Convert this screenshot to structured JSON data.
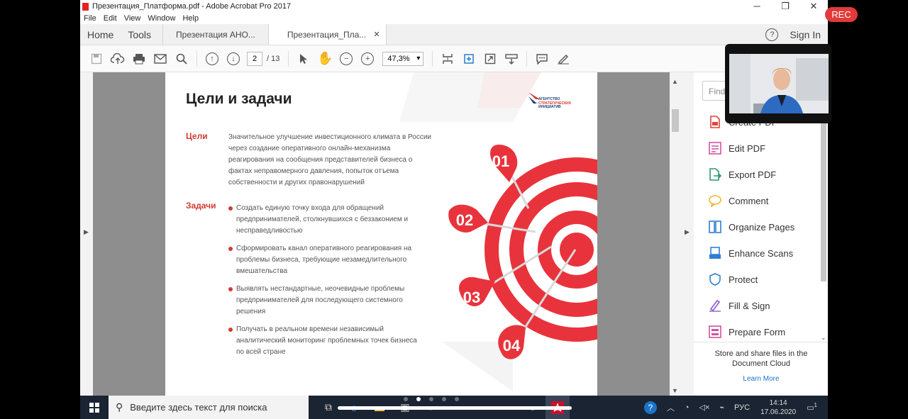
{
  "window": {
    "title": "Презентация_Платформа.pdf - Adobe Acrobat Pro 2017",
    "controls": {
      "minimize": "─",
      "maximize": "❐",
      "close": "✕"
    }
  },
  "menu": [
    "File",
    "Edit",
    "View",
    "Window",
    "Help"
  ],
  "tabs": {
    "home": "Home",
    "tools": "Tools",
    "docs": [
      {
        "label": "Презентация АНО..."
      },
      {
        "label": "Презентация_Пла...",
        "close": "✕"
      }
    ],
    "help": "?",
    "sign_in": "Sign In"
  },
  "toolbar": {
    "page_current": "2",
    "page_total": "/ 13",
    "zoom": "47,3%"
  },
  "slide": {
    "title": "Цели и задачи",
    "logo_text": "АГЕНТСТВО\nСТРАТЕГИЧЕСКИХ\nИНИЦИАТИВ",
    "goals_label": "Цели",
    "goals_text": "Значительное улучшение инвестиционного климата в России через создание оперативного онлайн-механизма реагирования на сообщения представителей бизнеса о фактах неправомерного давления, попыток отъема собственности и других правонарушений",
    "tasks_label": "Задачи",
    "tasks": [
      "Создать единую точку входа для обращений предпринимателей, столкнувшихся с беззаконием и несправедливостью",
      "Сформировать канал оперативного реагирования на проблемы бизнеса, требующие незамедлительного вмешательства",
      "Выявлять нестандартные, неочевидные проблемы предпринимателей для последующего системного решения",
      "Получать в реальном времени независимый аналитический мониторинг проблемных точек бизнеса по всей стране"
    ],
    "darts": [
      "01",
      "02",
      "03",
      "04"
    ]
  },
  "right_panel": {
    "find_placeholder": "Find",
    "tools": [
      {
        "label": "Create PDF",
        "icon": "create-pdf-icon",
        "color": "#e0433a"
      },
      {
        "label": "Edit PDF",
        "icon": "edit-pdf-icon",
        "color": "#d44fa5"
      },
      {
        "label": "Export PDF",
        "icon": "export-pdf-icon",
        "color": "#2f9a6e"
      },
      {
        "label": "Comment",
        "icon": "comment-icon",
        "color": "#f2b630"
      },
      {
        "label": "Organize Pages",
        "icon": "organize-pages-icon",
        "color": "#2e7fd3"
      },
      {
        "label": "Enhance Scans",
        "icon": "enhance-scans-icon",
        "color": "#2e7fd3"
      },
      {
        "label": "Protect",
        "icon": "protect-icon",
        "color": "#2e7fd3"
      },
      {
        "label": "Fill & Sign",
        "icon": "fill-sign-icon",
        "color": "#8a5ccf"
      },
      {
        "label": "Prepare Form",
        "icon": "prepare-form-icon",
        "color": "#d44fa5"
      }
    ],
    "cloud_text": "Store and share files in the Document Cloud",
    "learn_more": "Learn More"
  },
  "taskbar": {
    "search_placeholder": "Введите здесь текст для поиска",
    "lang": "РУС",
    "time": "14:14",
    "date": "17.06.2020",
    "notifications": "1"
  },
  "overlay": {
    "rec": "REC"
  },
  "colors": {
    "accent_red": "#d23b32",
    "taskbar": "#1b2433"
  }
}
